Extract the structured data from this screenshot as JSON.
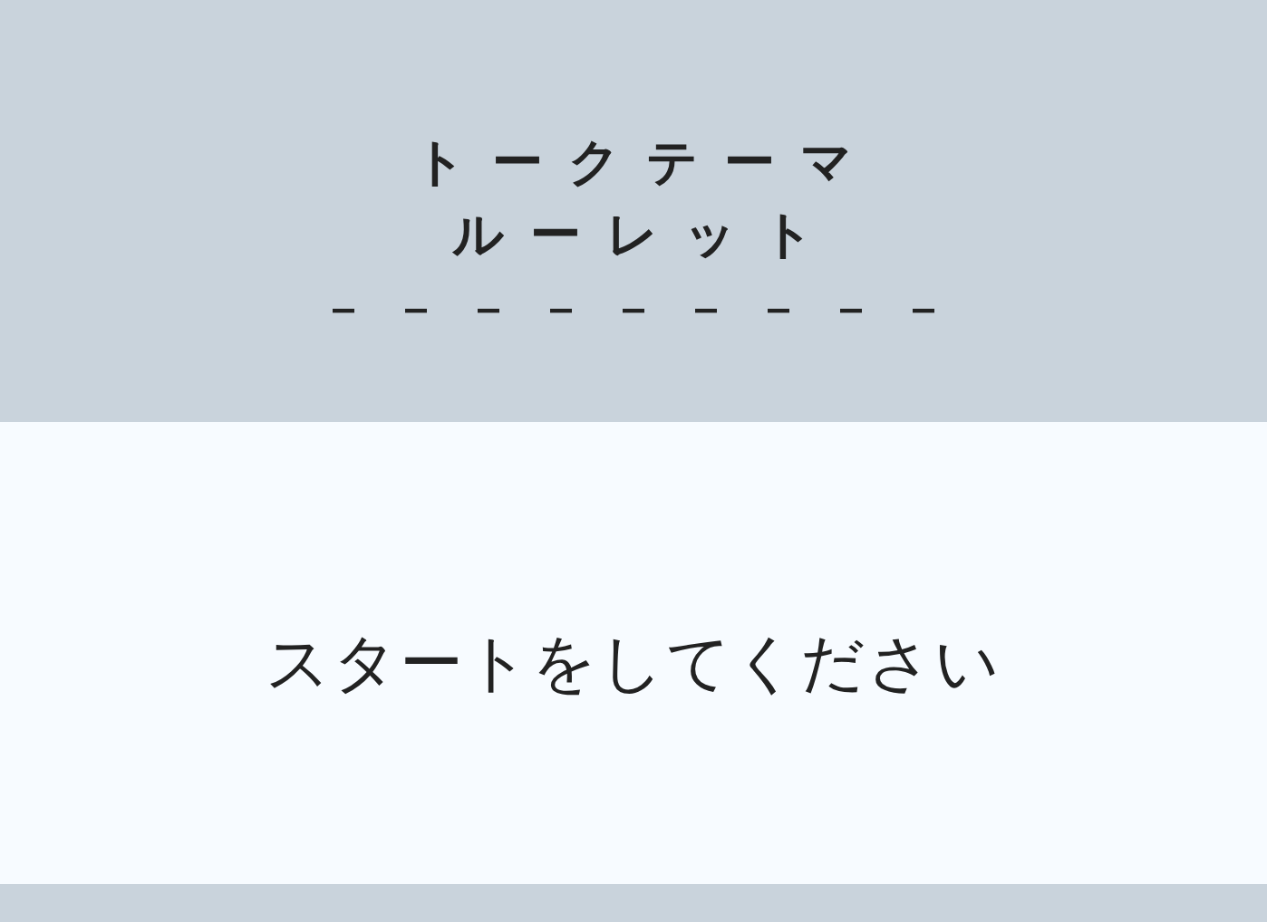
{
  "header": {
    "title_lines": [
      "トークテーマ",
      "ルーレット"
    ],
    "divider_text": "_________"
  },
  "main": {
    "message": "スタートをしてください"
  }
}
